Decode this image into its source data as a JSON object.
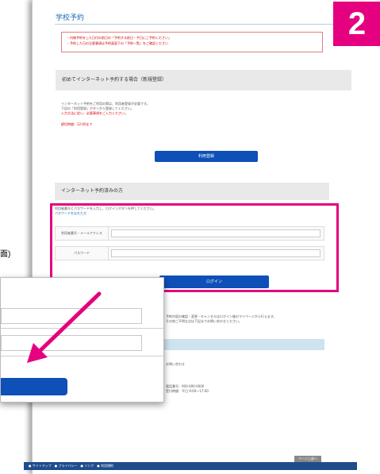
{
  "page": {
    "title": "学校予約",
    "badge": "2",
    "side_label": "面)"
  },
  "notice": {
    "line1": "・内線予約をした日付の前日の「予約する前日・平日にご予約ください」",
    "line2": "・予約した日の注意事項は予約画面下の「予約一覧」をご確認ください"
  },
  "section1": {
    "heading": "初めてインターネット予約する場合（新規登録）",
    "text1": "インターネット予約をご利用の際は、利用者登録が必要です。",
    "text2": "下記の「利用登録」ボタンから登録してください。",
    "red_text": "入力方法に従い、必要事項をご入力ください。",
    "note": "締切時間：12:00まで",
    "button": "利用登録"
  },
  "section2": {
    "heading": "インターネット予約済みの方",
    "desc1": "利用者番号とパスワードを入力し、ログインボタンを押してください。",
    "desc2": "パスワードを忘れた方",
    "row1_label": "利用者番号・メールアドレス",
    "row2_label": "パスワード",
    "button": "ログイン"
  },
  "lower": {
    "text1": "予約内容の確認・変更・キャンセルはログイン後のマイページから行えます。",
    "text2": "その他ご不明な点は下記までお問い合わせください。",
    "text3": "お問い合わせ",
    "text4": "電話番号：000-000-0000",
    "text5": "受付時間：平日 9:00〜17:00"
  },
  "footer": {
    "links": "● サイトマップ　● プライバシー　● リンク　● 利用規約",
    "top_button": "ページ上部へ"
  }
}
